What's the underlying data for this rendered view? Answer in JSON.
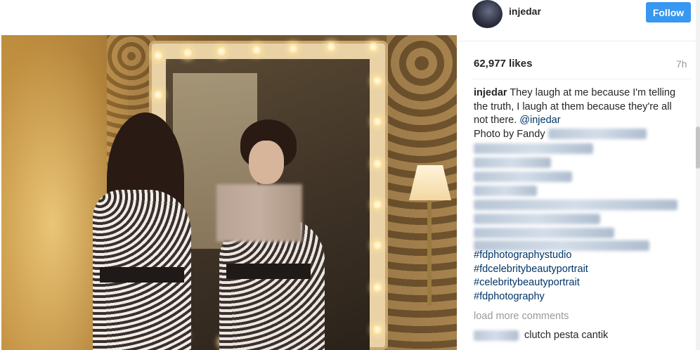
{
  "post": {
    "username": "injedar",
    "follow_label": "Follow",
    "likes": "62,977 likes",
    "time_ago": "7h",
    "caption": {
      "username": "injedar",
      "text": "They laugh at me because I'm telling the truth, I laugh at them because they're all not there.",
      "mention": "@injedar",
      "credit_prefix": "Photo by Fandy"
    },
    "hashtags": [
      "#fdphotographystudio",
      "#fdcelebritybeautyportrait",
      "#celebritybeautyportrait",
      "#fdphotography"
    ],
    "load_more": "load more comments",
    "comment": {
      "text": "clutch pesta cantik"
    }
  },
  "colors": {
    "follow_button": "#3897f0",
    "link": "#003569",
    "muted": "#999999",
    "text": "#262626"
  },
  "icons": {
    "avatar": "profile-avatar"
  }
}
